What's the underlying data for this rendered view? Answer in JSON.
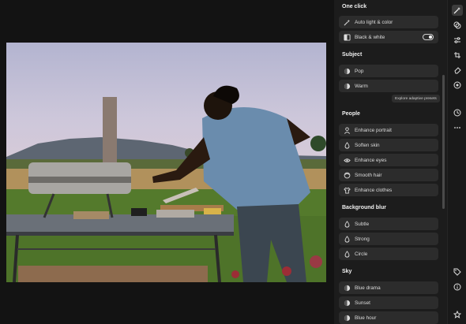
{
  "sections": [
    {
      "title": "One click",
      "items": [
        {
          "label": "Auto light & color",
          "icon": "auto-wand-icon"
        },
        {
          "label": "Black & white",
          "icon": "black-white-icon",
          "toggle": "off"
        }
      ]
    },
    {
      "title": "Subject",
      "items": [
        {
          "label": "Pop",
          "icon": "preset-icon"
        },
        {
          "label": "Warm",
          "icon": "preset-icon"
        }
      ]
    },
    {
      "title": "People",
      "items": [
        {
          "label": "Enhance portrait",
          "icon": "person-icon"
        },
        {
          "label": "Soften skin",
          "icon": "droplet-icon"
        },
        {
          "label": "Enhance eyes",
          "icon": "eye-icon"
        },
        {
          "label": "Smooth hair",
          "icon": "hair-icon"
        },
        {
          "label": "Enhance clothes",
          "icon": "shirt-icon"
        }
      ]
    },
    {
      "title": "Background blur",
      "items": [
        {
          "label": "Subtle",
          "icon": "droplet-icon"
        },
        {
          "label": "Strong",
          "icon": "droplet-icon"
        },
        {
          "label": "Circle",
          "icon": "droplet-icon"
        }
      ]
    },
    {
      "title": "Sky",
      "items": [
        {
          "label": "Blue drama",
          "icon": "preset-icon"
        },
        {
          "label": "Sunset",
          "icon": "preset-icon"
        },
        {
          "label": "Blue hour",
          "icon": "preset-icon"
        }
      ]
    }
  ],
  "tooltip": "Explore adaptive presets",
  "rail_top": [
    "quick-actions-icon",
    "layers-icon",
    "adjust-sliders-icon",
    "crop-icon",
    "eraser-icon",
    "target-icon",
    "history-icon",
    "more-icon"
  ],
  "rail_bottom": [
    "tag-icon",
    "info-icon",
    "star-icon"
  ],
  "colors": {
    "accent": "#ffffff",
    "panel": "#1c1c1c",
    "button": "#2c2c2c"
  }
}
